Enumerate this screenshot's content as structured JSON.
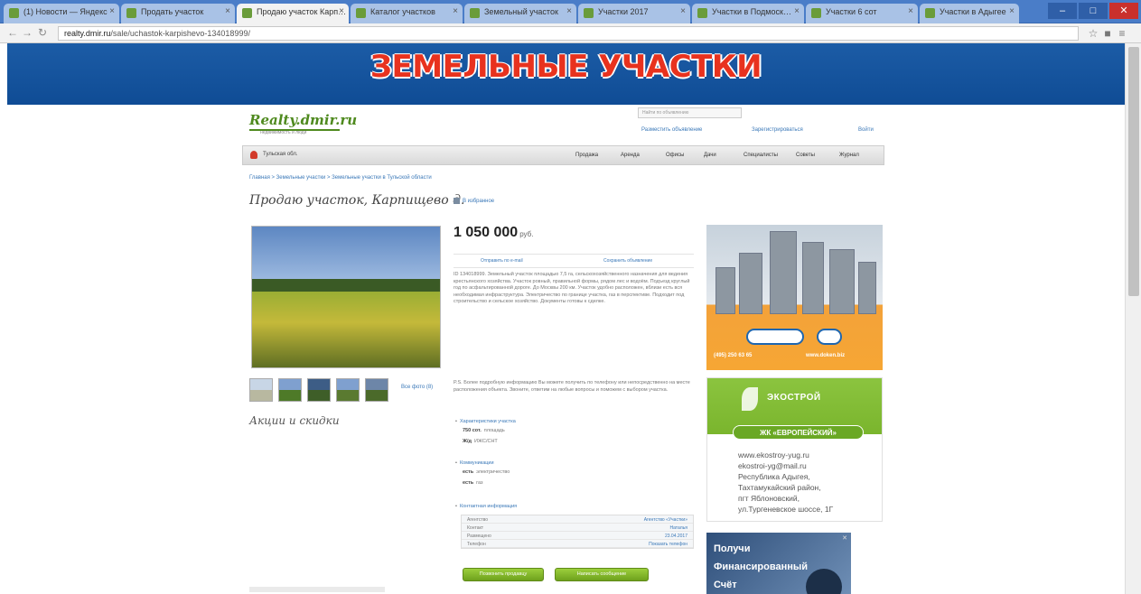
{
  "browser": {
    "tabs": [
      {
        "label": "(1) Новости — Яндекс",
        "active": false
      },
      {
        "label": "Продать участок",
        "active": false
      },
      {
        "label": "Продаю участок Карп…",
        "active": true
      },
      {
        "label": "Каталог участков",
        "active": false
      },
      {
        "label": "Земельный участок",
        "active": false
      },
      {
        "label": "Участки 2017",
        "active": false
      },
      {
        "label": "Участки в Подмоск…",
        "active": false
      },
      {
        "label": "Участки 6 сот",
        "active": false
      },
      {
        "label": "Участки в Адыгее",
        "active": false
      }
    ],
    "url_domain": "realty.dmir.ru",
    "url_path": "/sale/uchastok-karpishevo-134018999/",
    "controls": {
      "minimize": "–",
      "maximize": "□",
      "close": "✕"
    }
  },
  "banner": {
    "title": "ЗЕМЕЛЬНЫЕ УЧАСТКИ"
  },
  "header": {
    "logo": "Realty.dmir.ru",
    "logo_tagline": "недвижимость и люди",
    "search_placeholder": "Найти по объявлению",
    "links": [
      "Разместить объявление",
      "Зарегистрироваться",
      "Войти"
    ]
  },
  "nav": {
    "city": "Тульская обл.",
    "items": [
      "Продажа",
      "Аренда",
      "Офисы",
      "Дачи",
      "Специалисты",
      "Советы",
      "Журнал"
    ]
  },
  "breadcrumb": "Главная  >  Земельные участки  >  Земельные участки в Тульской области",
  "listing": {
    "title": "Продаю участок, Карпищево д.",
    "favorite_label": "В избранное",
    "price": "1 050 000",
    "currency": "руб.",
    "link_send": "Отправить по e-mail",
    "link_fav": "Сохранить объявление",
    "description": "ID 134018999. Земельный участок площадью 7,5 га, сельскохозяйственного назначения для ведения крестьянского хозяйства. Участок ровный, правильной формы, рядом лес и водоём. Подъезд круглый год по асфальтированной дороге. До Москвы 200 км. Участок удобно расположен, вблизи есть вся необходимая инфраструктура. Электричество по границе участка, газ в перспективе. Подходит под строительство и сельское хозяйство. Документы готовы к сделке.",
    "description2": "P.S. Более подробную информацию Вы можете получить по телефону или непосредственно на месте расположения объекта. Звоните, ответим на любые вопросы и поможем с выбором участка.",
    "all_photos": "Все фото (8)",
    "actions_heading": "Акции и скидки",
    "props": [
      {
        "heading": "Характеристики участка",
        "values": [
          {
            "bold": "750 сот.",
            "text": "площадь"
          },
          {
            "bold": "Ж/д",
            "text": "ИЖС/СНТ"
          }
        ]
      },
      {
        "heading": "Коммуникации",
        "values": [
          {
            "bold": "есть",
            "text": "электричество"
          },
          {
            "bold": "есть",
            "text": "газ"
          }
        ]
      },
      {
        "heading": "Контактная информация",
        "values": []
      }
    ],
    "contacts": [
      {
        "key": "Агентство",
        "value": "Агентство «Участки»"
      },
      {
        "key": "Контакт",
        "value": "Наталья"
      },
      {
        "key": "Размещено",
        "value": "23.04.2017"
      },
      {
        "key": "Телефон",
        "value": "Показать телефон"
      }
    ],
    "btn_call": "Позвонить продавцу",
    "btn_message": "Написать сообщение"
  },
  "ads": {
    "ad1": {
      "phone": "(495) 250 63 65",
      "site": "www.doken.biz"
    },
    "ad2": {
      "brand": "ЭКОСТРОЙ",
      "tag": "ЖК «ЕВРОПЕЙСКИЙ»",
      "lines": [
        "www.ekostroy-yug.ru",
        "ekostroi-yg@mail.ru",
        "Республика Адыгея,",
        "Тахтамукайский район,",
        "пгт Яблоновский,",
        "ул.Тургеневское шоссе, 1Г"
      ]
    },
    "ad3": {
      "lines": [
        "Получи",
        "Финансированный",
        "Счёт"
      ],
      "close": "✕"
    }
  },
  "colors": {
    "accent": "#3a78b8",
    "brand_green": "#4f8a1f",
    "banner_blue": "#1c5ca6",
    "title_red": "#e8321e"
  }
}
